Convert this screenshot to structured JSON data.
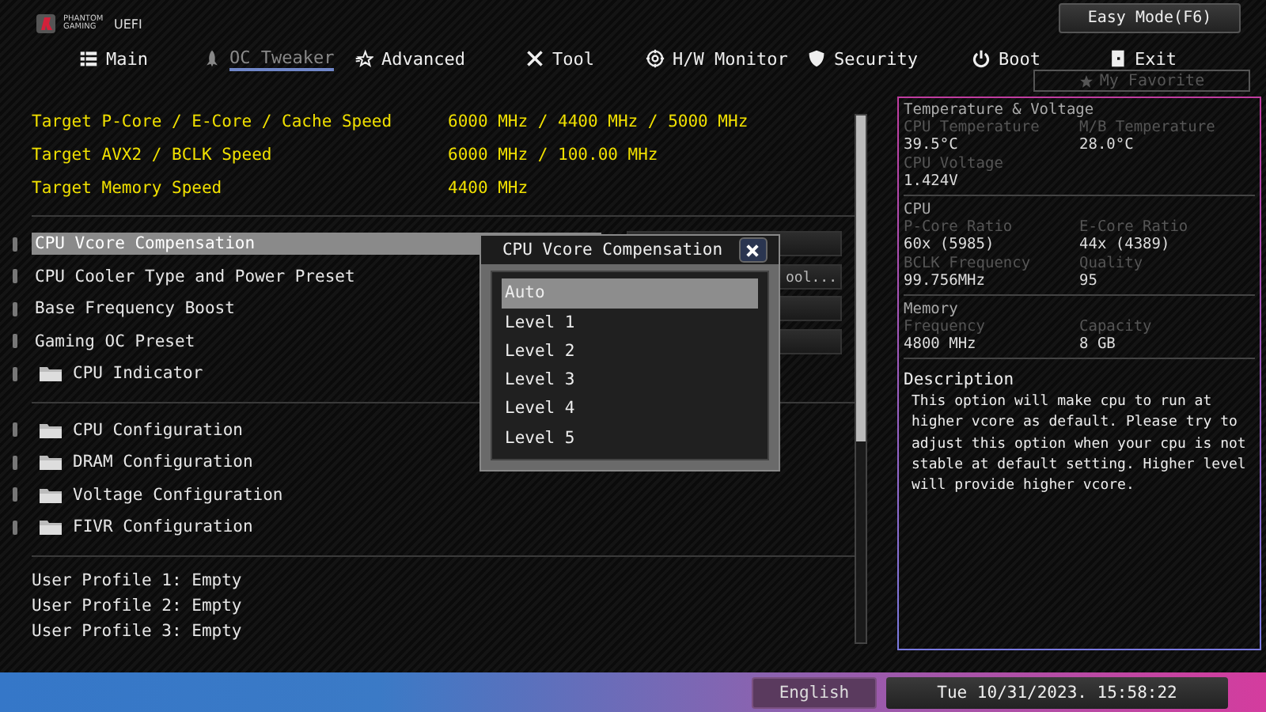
{
  "header": {
    "brand": "PHANTOM GAMING",
    "product": "UEFI",
    "easy_mode": "Easy Mode(F6)",
    "favorite": "My Favorite"
  },
  "tabs": [
    {
      "label": "Main",
      "selected": false
    },
    {
      "label": "OC Tweaker",
      "selected": true
    },
    {
      "label": "Advanced",
      "selected": false
    },
    {
      "label": "Tool",
      "selected": false
    },
    {
      "label": "H/W Monitor",
      "selected": false
    },
    {
      "label": "Security",
      "selected": false
    },
    {
      "label": "Boot",
      "selected": false
    },
    {
      "label": "Exit",
      "selected": false
    }
  ],
  "targets": [
    {
      "label": "Target P-Core / E-Core / Cache Speed",
      "value": "6000 MHz / 4400 MHz / 5000 MHz"
    },
    {
      "label": "Target AVX2 / BCLK Speed",
      "value": "6000 MHz / 100.00 MHz"
    },
    {
      "label": "Target Memory Speed",
      "value": "4400 MHz"
    }
  ],
  "settings": [
    {
      "label": "CPU Vcore Compensation",
      "kind": "setting",
      "selected": true
    },
    {
      "label": "CPU Cooler Type and Power Preset",
      "kind": "setting",
      "selected": false,
      "value": "ool..."
    },
    {
      "label": "Base Frequency Boost",
      "kind": "setting",
      "selected": false
    },
    {
      "label": "Gaming OC Preset",
      "kind": "setting",
      "selected": false
    },
    {
      "label": "CPU Indicator",
      "kind": "folder",
      "selected": false
    }
  ],
  "configs": [
    {
      "label": "CPU Configuration"
    },
    {
      "label": "DRAM Configuration"
    },
    {
      "label": "Voltage Configuration"
    },
    {
      "label": "FIVR Configuration"
    }
  ],
  "profiles": [
    "User Profile 1: Empty",
    "User Profile 2: Empty",
    "User Profile 3: Empty"
  ],
  "popup": {
    "title": "CPU Vcore Compensation",
    "options": [
      {
        "label": "Auto",
        "selected": true
      },
      {
        "label": "Level 1",
        "selected": false
      },
      {
        "label": "Level 2",
        "selected": false
      },
      {
        "label": "Level 3",
        "selected": false
      },
      {
        "label": "Level 4",
        "selected": false
      },
      {
        "label": "Level 5",
        "selected": false
      }
    ]
  },
  "monitor": [
    {
      "title": "Temperature & Voltage",
      "fields": [
        {
          "label": "CPU Temperature",
          "value": "39.5°C"
        },
        {
          "label": "M/B Temperature",
          "value": "28.0°C"
        },
        {
          "label": "CPU Voltage",
          "value": "1.424V"
        }
      ]
    },
    {
      "title": "CPU",
      "fields": [
        {
          "label": "P-Core Ratio",
          "value": "60x (5985)"
        },
        {
          "label": "E-Core Ratio",
          "value": "44x (4389)"
        },
        {
          "label": "BCLK Frequency",
          "value": "99.756MHz"
        },
        {
          "label": "Quality",
          "value": "95"
        }
      ]
    },
    {
      "title": "Memory",
      "fields": [
        {
          "label": "Frequency",
          "value": "4800 MHz"
        },
        {
          "label": "Capacity",
          "value": "8 GB"
        }
      ]
    }
  ],
  "description": {
    "title": "Description",
    "text": "This option will make cpu to run at higher vcore as default. Please try to adjust this option when your cpu is not stable at default setting. Higher level will provide higher vcore."
  },
  "status_bar": {
    "language": "English",
    "datetime": "Tue 10/31/2023. 15:58:22"
  }
}
